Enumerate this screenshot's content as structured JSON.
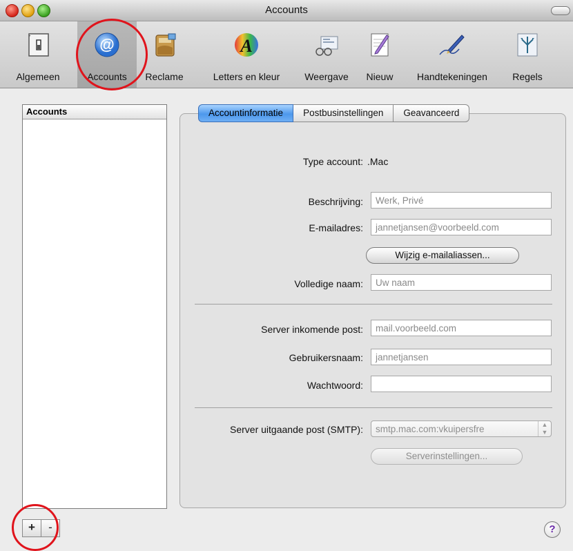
{
  "window": {
    "title": "Accounts"
  },
  "toolbar": {
    "items": [
      {
        "label": "Algemeen",
        "icon": "switch-icon"
      },
      {
        "label": "Accounts",
        "icon": "at-sign-icon"
      },
      {
        "label": "Reclame",
        "icon": "junk-mail-icon"
      },
      {
        "label": "Letters en kleur",
        "icon": "font-color-icon"
      },
      {
        "label": "Weergave",
        "icon": "viewing-glasses-icon"
      },
      {
        "label": "Nieuw",
        "icon": "compose-icon"
      },
      {
        "label": "Handtekeningen",
        "icon": "signature-pen-icon"
      },
      {
        "label": "Regels",
        "icon": "rules-icon"
      }
    ],
    "selected": "Accounts"
  },
  "sidebar": {
    "header": "Accounts",
    "add_label": "+",
    "remove_label": "-"
  },
  "tabs": [
    {
      "label": "Accountinformatie",
      "active": true
    },
    {
      "label": "Postbusinstellingen",
      "active": false
    },
    {
      "label": "Geavanceerd",
      "active": false
    }
  ],
  "form": {
    "type_label": "Type account:",
    "type_value": ".Mac",
    "description_label": "Beschrijving:",
    "description_placeholder": "Werk, Privé",
    "email_label": "E-mailadres:",
    "email_placeholder": "jannetjansen@voorbeeld.com",
    "alias_button": "Wijzig e-mailaliassen...",
    "fullname_label": "Volledige naam:",
    "fullname_placeholder": "Uw naam",
    "incoming_label": "Server inkomende post:",
    "incoming_placeholder": "mail.voorbeeld.com",
    "username_label": "Gebruikersnaam:",
    "username_placeholder": "jannetjansen",
    "password_label": "Wachtwoord:",
    "password_value": "",
    "smtp_label": "Server uitgaande post (SMTP):",
    "smtp_value": "smtp.mac.com:vkuipersfre",
    "server_settings_button": "Serverinstellingen..."
  },
  "help_label": "?",
  "colors": {
    "highlight": "#e0141c",
    "accent": "#4d98ec"
  }
}
